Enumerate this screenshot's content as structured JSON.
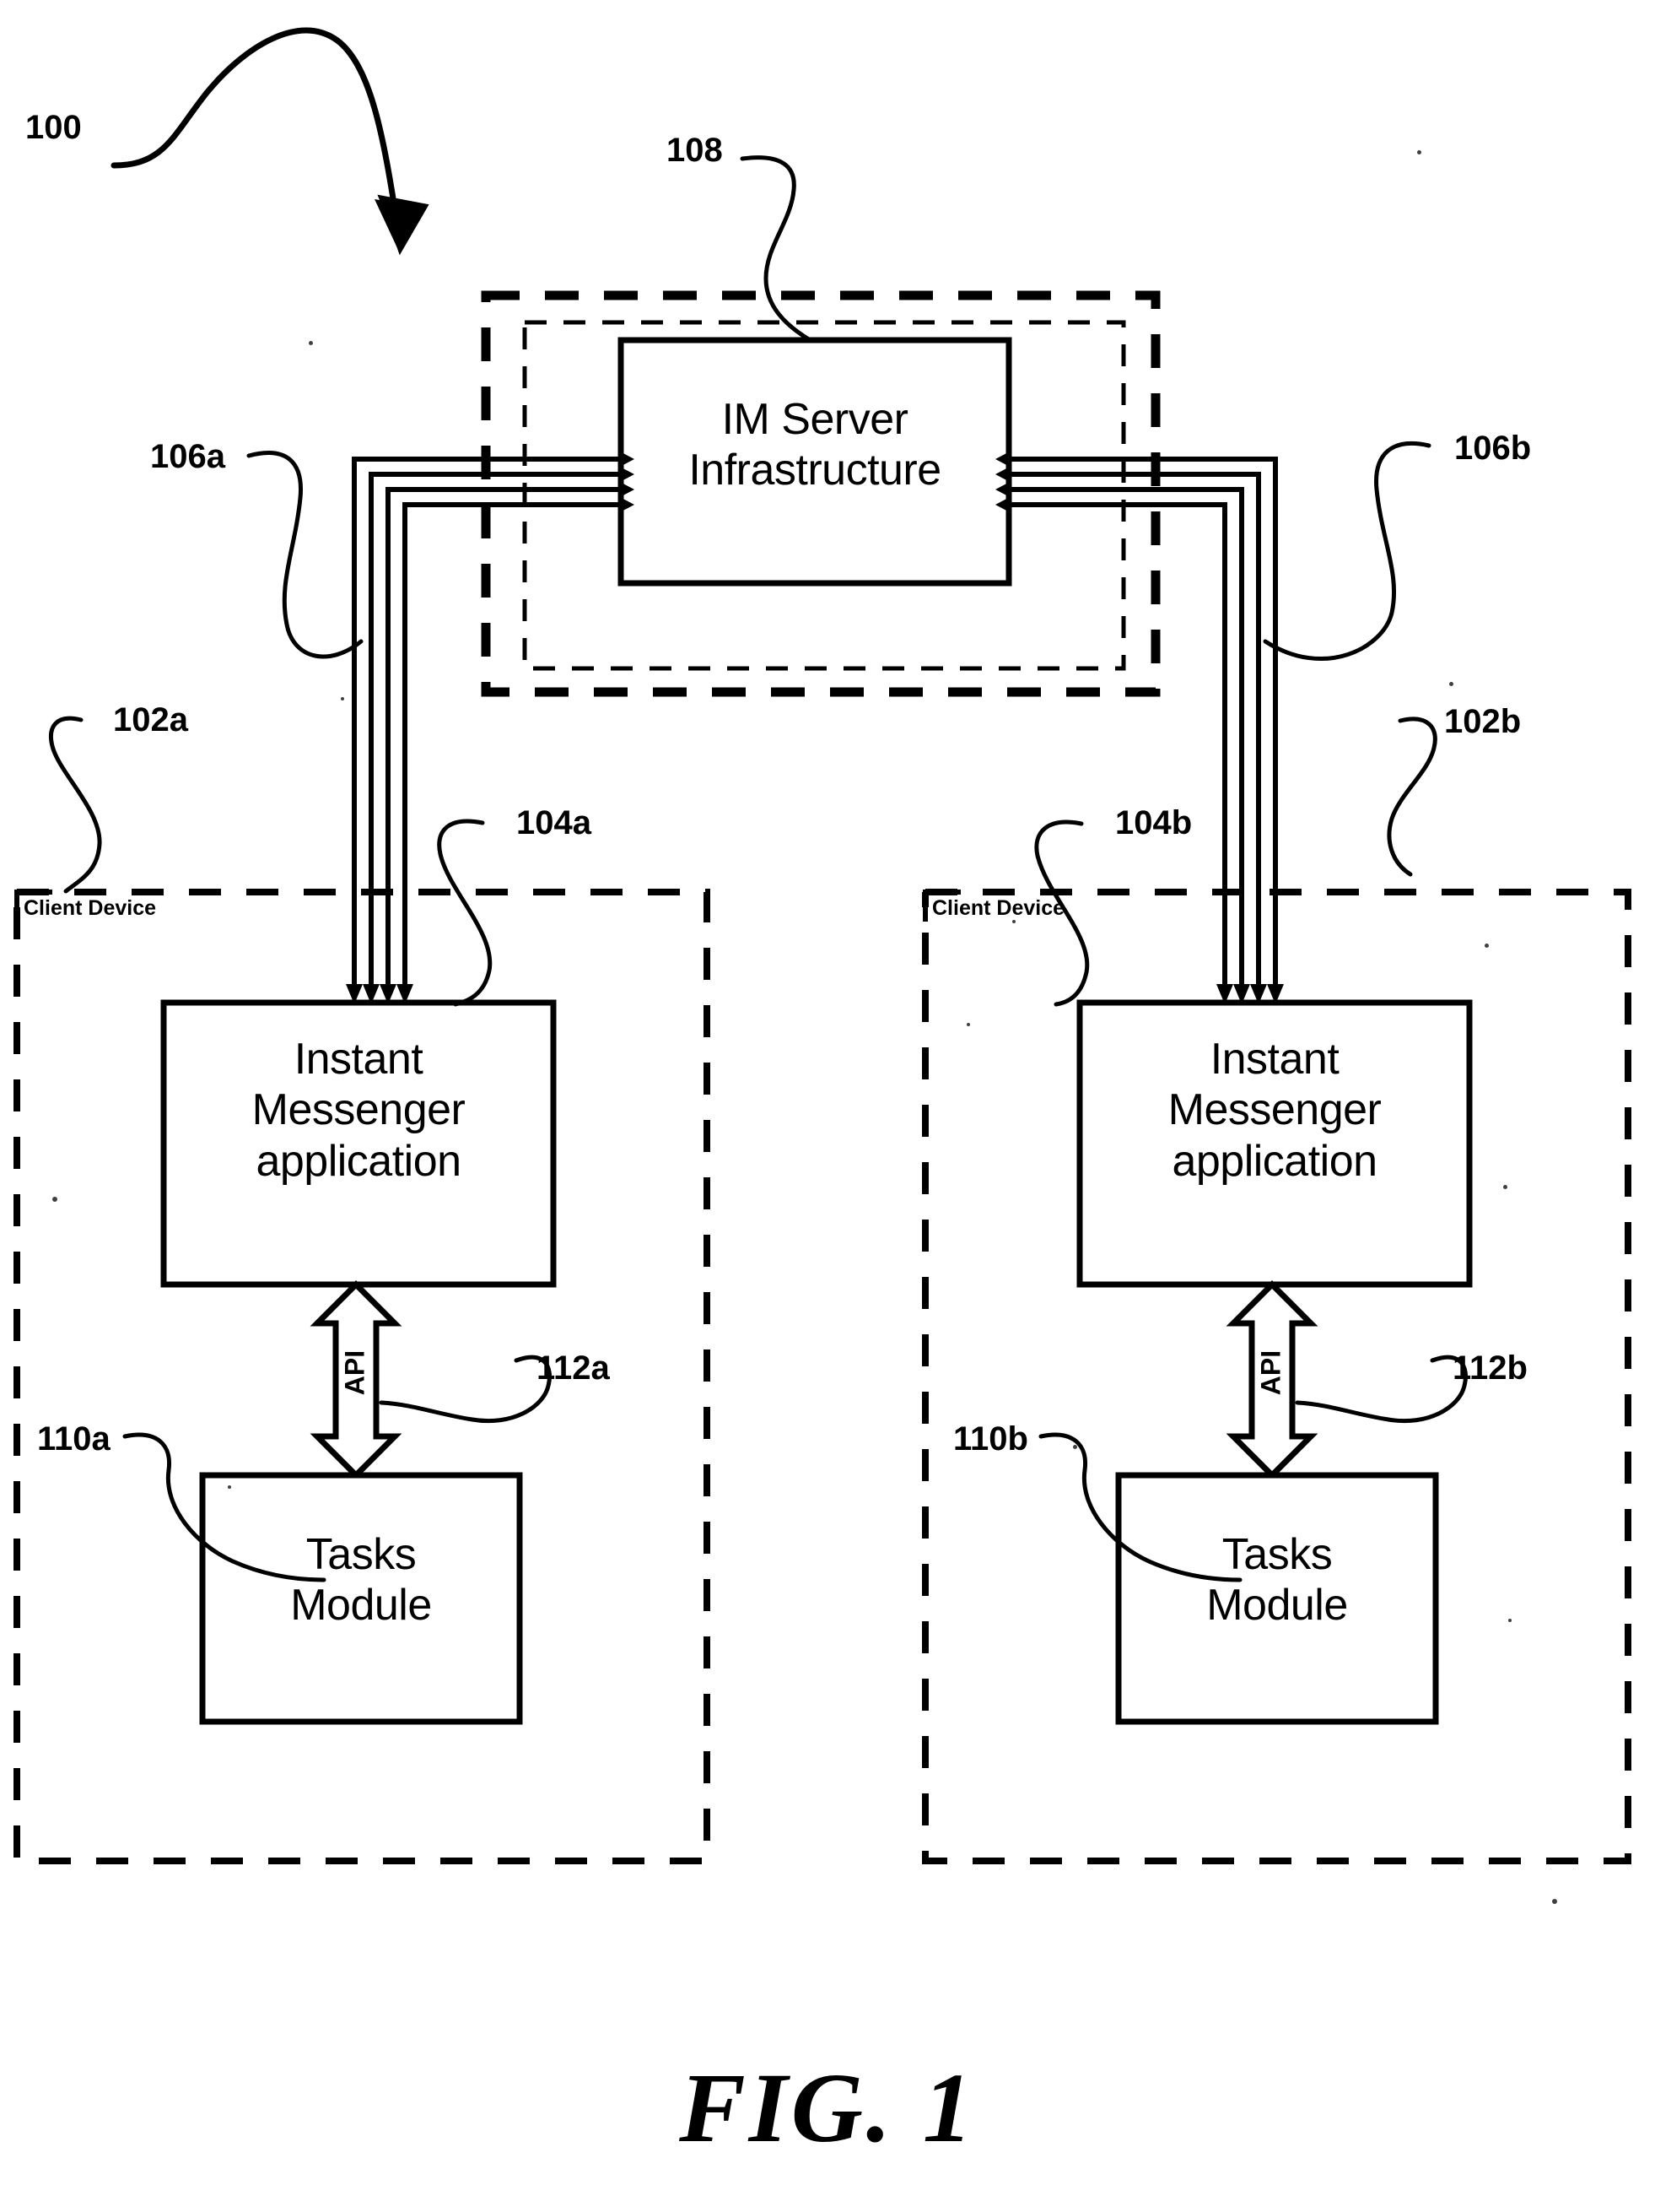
{
  "figure": {
    "caption": "FIG. 1",
    "system_ref": "100"
  },
  "server": {
    "ref": "108",
    "title_line1": "IM Server",
    "title_line2": "Infrastructure"
  },
  "links": {
    "left_ref": "106a",
    "right_ref": "106b",
    "channel_count": 4
  },
  "clients": [
    {
      "device_ref": "102a",
      "device_caption": "Client Device",
      "app_ref": "104a",
      "app_line1": "Instant",
      "app_line2": "Messenger",
      "app_line3": "application",
      "api_ref": "112a",
      "api_label": "API",
      "tasks_ref": "110a",
      "tasks_line1": "Tasks",
      "tasks_line2": "Module"
    },
    {
      "device_ref": "102b",
      "device_caption": "Client Device",
      "app_ref": "104b",
      "app_line1": "Instant",
      "app_line2": "Messenger",
      "app_line3": "application",
      "api_ref": "112b",
      "api_label": "API",
      "tasks_ref": "110b",
      "tasks_line1": "Tasks",
      "tasks_line2": "Module"
    }
  ],
  "colors": {
    "ink": "#000000",
    "paper": "#ffffff"
  }
}
